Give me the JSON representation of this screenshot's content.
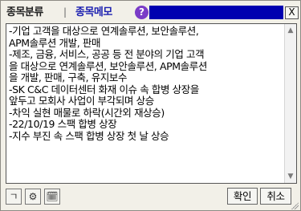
{
  "titlebar": {
    "tab_classify": "종목분류",
    "separator": "|",
    "tab_memo": "종목메모",
    "help_glyph": "?",
    "close_glyph": "X"
  },
  "memo": {
    "lines": [
      "-기업 고객을 대상으로 연계솔루션, 보안솔루션,",
      "APM솔루션 개발, 판매",
      "-제조, 금융, 서비스, 공공 등 전 분야의 기업 고객",
      "을 대상으로 연계솔루션, 보안솔루션, APM솔루션",
      "을 개발, 판매, 구축, 유지보수",
      "-SK C&C 데이터센터 화재 이슈 속 합병 상장을",
      "앞두고 모회사 사업이 부각되며 상승",
      "-차익 실현 매물로 하락(시간외 재상승)",
      "-22/10/19 스팩 합병 상장",
      "-지수 부진 속 스팩 합병 상장 첫 날 상승"
    ]
  },
  "scrollbar": {
    "up_glyph": "▲",
    "down_glyph": "▼"
  },
  "toolbar": {
    "tool1_glyph": "ㄱ",
    "tool2_glyph": "⚙",
    "tool3_glyph": "🗓",
    "ok_label": "확인",
    "cancel_label": "취소"
  },
  "colors": {
    "title_fill": "#0000b0",
    "memo_tab": "#1b1fb0",
    "help_icon": "#7a3cc7"
  }
}
